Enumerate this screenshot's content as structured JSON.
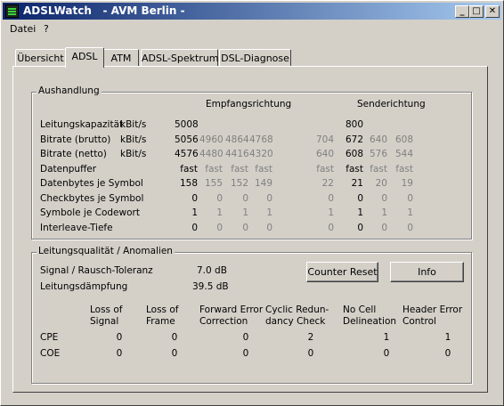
{
  "window": {
    "title": "ADSLWatch   - AVM Berlin -"
  },
  "menu": [
    "Datei",
    "?"
  ],
  "tabs": [
    "Übersicht",
    "ADSL",
    "ATM",
    "ADSL-Spektrum",
    "DSL-Diagnose"
  ],
  "active_tab": "ADSL",
  "aushandlung": {
    "legend": "Aushandlung",
    "empfang_header": "Empfangsrichtung",
    "sende_header": "Senderichtung",
    "rows": [
      {
        "label": "Leitungskapazität",
        "unit": "kBit/s",
        "empfang": [
          "5008",
          "",
          "",
          ""
        ],
        "sende": [
          "",
          "800",
          "",
          ""
        ]
      },
      {
        "label": "Bitrate (brutto)",
        "unit": "kBit/s",
        "empfang": [
          "5056",
          "4960",
          "4864",
          "4768"
        ],
        "sende": [
          "704",
          "672",
          "640",
          "608"
        ]
      },
      {
        "label": "Bitrate (netto)",
        "unit": "kBit/s",
        "empfang": [
          "4576",
          "4480",
          "4416",
          "4320"
        ],
        "sende": [
          "640",
          "608",
          "576",
          "544"
        ]
      },
      {
        "label": "Datenpuffer",
        "unit": "",
        "empfang": [
          "fast",
          "fast",
          "fast",
          "fast"
        ],
        "sende": [
          "fast",
          "fast",
          "fast",
          "fast"
        ]
      },
      {
        "label": "Datenbytes je Symbol",
        "unit": "",
        "empfang": [
          "158",
          "155",
          "152",
          "149"
        ],
        "sende": [
          "22",
          "21",
          "20",
          "19"
        ]
      },
      {
        "label": "Checkbytes je Symbol",
        "unit": "",
        "empfang": [
          "0",
          "0",
          "0",
          "0"
        ],
        "sende": [
          "0",
          "0",
          "0",
          "0"
        ]
      },
      {
        "label": "Symbole je Codewort",
        "unit": "",
        "empfang": [
          "1",
          "1",
          "1",
          "1"
        ],
        "sende": [
          "1",
          "1",
          "1",
          "1"
        ]
      },
      {
        "label": "Interleave-Tiefe",
        "unit": "",
        "empfang": [
          "0",
          "0",
          "0",
          "0"
        ],
        "sende": [
          "0",
          "0",
          "0",
          "0"
        ]
      }
    ]
  },
  "qualitaet": {
    "legend": "Leitungsqualität / Anomalien",
    "snr_label": "Signal / Rausch-Toleranz",
    "snr_value": "7.0 dB",
    "attn_label": "Leitungsdämpfung",
    "attn_value": "39.5 dB",
    "counter_reset": "Counter Reset",
    "info": "Info",
    "columns": [
      {
        "line1": "Loss of",
        "line2": "Signal"
      },
      {
        "line1": "Loss of",
        "line2": "Frame"
      },
      {
        "line1": "Forward Error",
        "line2": "Correction"
      },
      {
        "line1": "Cyclic Redun-",
        "line2": "dancy Check"
      },
      {
        "line1": "No Cell",
        "line2": "Delineation"
      },
      {
        "line1": "Header Error",
        "line2": "Control"
      }
    ],
    "rows": [
      {
        "label": "CPE",
        "values": [
          "0",
          "0",
          "0",
          "2",
          "1",
          "1"
        ]
      },
      {
        "label": "COE",
        "values": [
          "0",
          "0",
          "0",
          "0",
          "0",
          "0"
        ]
      }
    ]
  }
}
